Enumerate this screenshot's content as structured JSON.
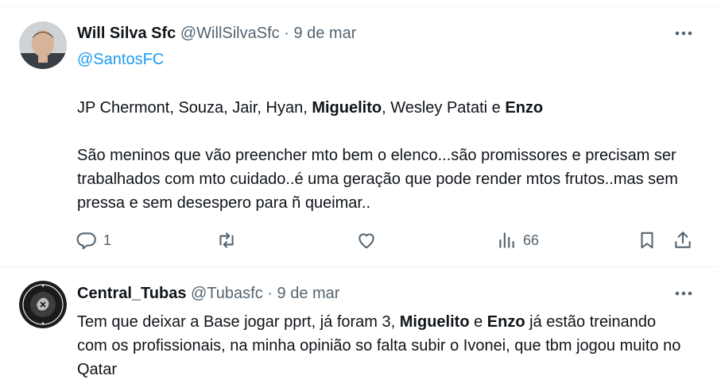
{
  "tweets": [
    {
      "author_name": "Will Silva Sfc",
      "handle": "@WillSilvaSfc",
      "sep": "·",
      "date": "9 de mar",
      "replying_to": "@SantosFC",
      "line1": [
        {
          "t": "JP Chermont, Souza, Jair, Hyan, ",
          "b": false
        },
        {
          "t": "Miguelito",
          "b": true
        },
        {
          "t": ", Wesley Patati e ",
          "b": false
        },
        {
          "t": "Enzo",
          "b": true
        }
      ],
      "paragraph2": "São meninos que vão preencher mto bem o elenco...são promissores e precisam ser trabalhados com mto cuidado..é uma geração que pode render mtos frutos..mas sem pressa e sem desespero para ñ queimar..",
      "actions": {
        "reply_count": "1",
        "views_count": "66"
      },
      "icons": [
        "reply-icon",
        "retweet-icon",
        "like-icon",
        "views-icon",
        "bookmark-icon",
        "share-icon",
        "more-icon"
      ]
    },
    {
      "author_name": "Central_Tubas",
      "handle": "@Tubasfc",
      "sep": "·",
      "date": "9 de mar",
      "text": [
        {
          "t": "Tem que deixar a Base jogar pprt, já foram 3, ",
          "b": false
        },
        {
          "t": "Miguelito",
          "b": true
        },
        {
          "t": " e ",
          "b": false
        },
        {
          "t": "Enzo",
          "b": true
        },
        {
          "t": " já estão treinando com os profissionais, na minha opinião so falta subir o Ivonei, que tbm jogou muito no Qatar",
          "b": false
        }
      ],
      "icons": [
        "more-icon"
      ]
    }
  ],
  "colors": {
    "text": "#0f1419",
    "muted": "#536471",
    "link": "#1d9bf0",
    "divider": "#eff3f4"
  }
}
